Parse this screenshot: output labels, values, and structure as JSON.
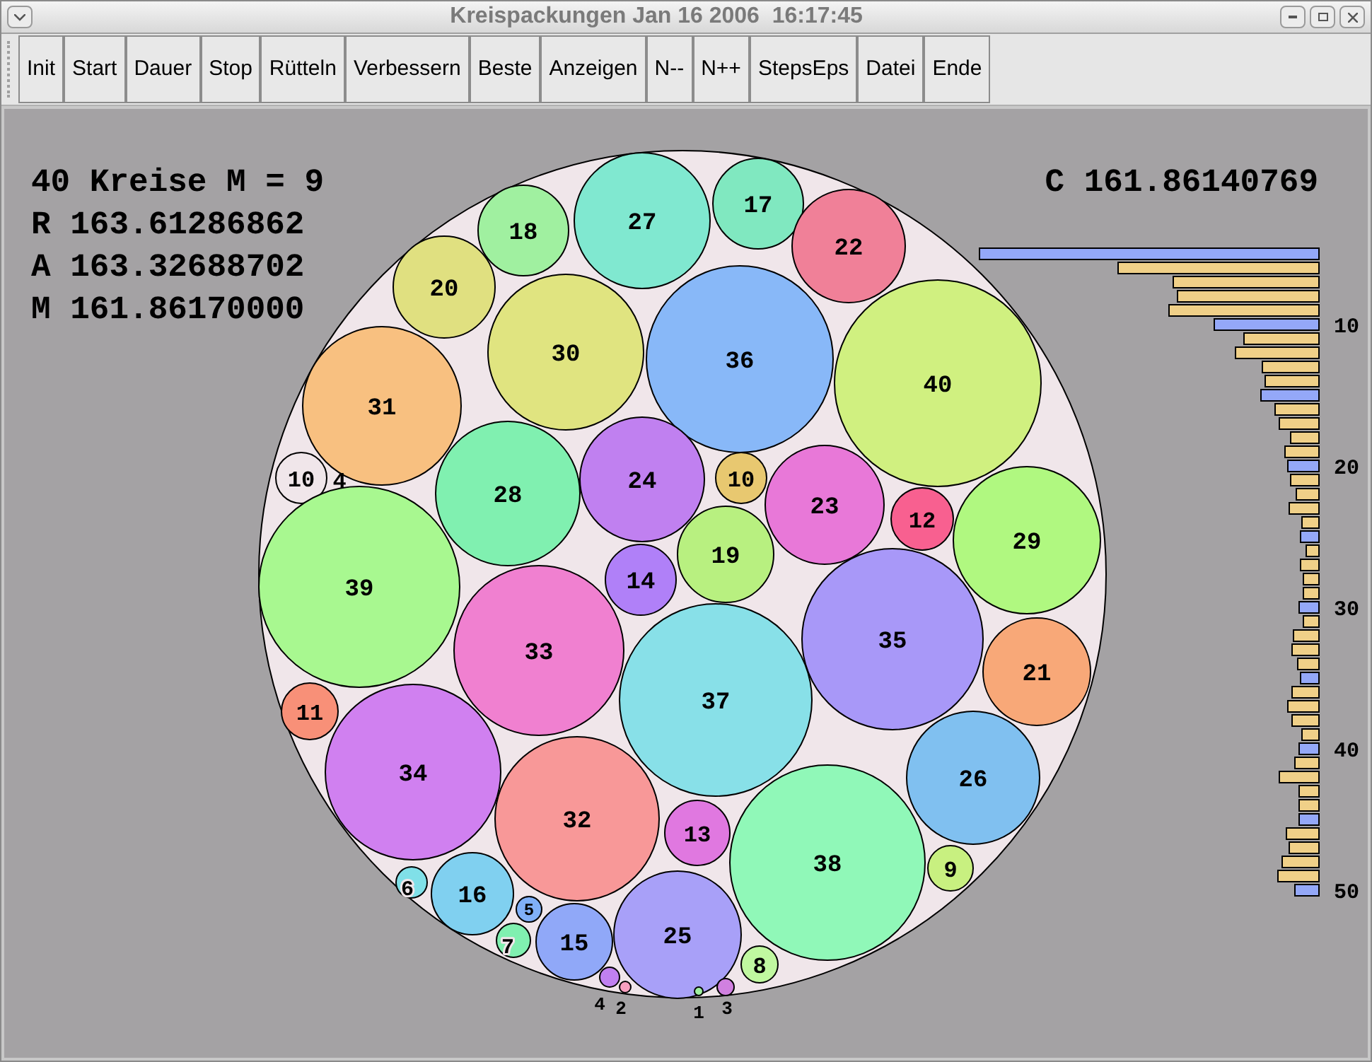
{
  "window": {
    "title": "Kreispackungen Jan 16 2006  16:17:45"
  },
  "toolbar": [
    "Init",
    "Start",
    "Dauer",
    "Stop",
    "Rütteln",
    "Verbessern",
    "Beste",
    "Anzeigen",
    "N--",
    "N++",
    "StepsEps",
    "Datei",
    "Ende"
  ],
  "stats_left": [
    "40 Kreise M = 9",
    "R 163.61286862",
    "A 163.32688702",
    "M 161.86170000"
  ],
  "stats_right": "C 161.86140769",
  "circles": [
    {
      "label": "17",
      "color": "#80e8c0"
    },
    {
      "label": "18",
      "color": "#a0f0a0"
    },
    {
      "label": "27",
      "color": "#80e8d0"
    },
    {
      "label": "22",
      "color": "#f08098"
    },
    {
      "label": "20",
      "color": "#e0e080"
    },
    {
      "label": "30",
      "color": "#e0e480"
    },
    {
      "label": "36",
      "color": "#88b8f8"
    },
    {
      "label": "40",
      "color": "#d0f080"
    },
    {
      "label": "31",
      "color": "#f8c080"
    },
    {
      "label": "10",
      "color": "#f0e6ea"
    },
    {
      "label": "28",
      "color": "#80f0b0"
    },
    {
      "label": "24",
      "color": "#c080f0"
    },
    {
      "label": "10",
      "color": "#e8c870"
    },
    {
      "label": "23",
      "color": "#e878d8"
    },
    {
      "label": "12",
      "color": "#f86090"
    },
    {
      "label": "29",
      "color": "#b0f880"
    },
    {
      "label": "39",
      "color": "#a8f890"
    },
    {
      "label": "14",
      "color": "#b080f8"
    },
    {
      "label": "19",
      "color": "#b8f080"
    },
    {
      "label": "33",
      "color": "#f080d0"
    },
    {
      "label": "35",
      "color": "#a898f8"
    },
    {
      "label": "37",
      "color": "#88e0e8"
    },
    {
      "label": "21",
      "color": "#f8a878"
    },
    {
      "label": "11",
      "color": "#f89078"
    },
    {
      "label": "34",
      "color": "#d080f0"
    },
    {
      "label": "26",
      "color": "#80c0f0"
    },
    {
      "label": "32",
      "color": "#f89898"
    },
    {
      "label": "13",
      "color": "#e078e0"
    },
    {
      "label": "38",
      "color": "#90f8b8"
    },
    {
      "label": "9",
      "color": "#c8f080"
    },
    {
      "label": "6",
      "color": "#80e0e8"
    },
    {
      "label": "16",
      "color": "#80d0f0"
    },
    {
      "label": "5",
      "color": "#80b0f8"
    },
    {
      "label": "7",
      "color": "#80f0b0"
    },
    {
      "label": "15",
      "color": "#90a8f8"
    },
    {
      "label": "25",
      "color": "#a8a0f8"
    },
    {
      "label": "8",
      "color": "#c0f8a0"
    },
    {
      "label": "4",
      "color": "#c080f0"
    },
    {
      "label": "2",
      "color": "#f8a0c0"
    },
    {
      "label": "1",
      "color": "#a0f0a0"
    },
    {
      "label": "3",
      "color": "#d080e0"
    }
  ],
  "loose_labels": [
    "4"
  ],
  "histogram": {
    "tick_labels": [
      "10",
      "20",
      "30",
      "40",
      "50"
    ]
  }
}
